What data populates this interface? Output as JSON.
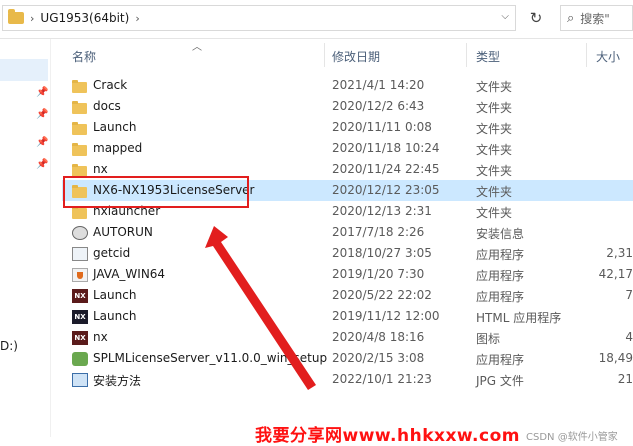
{
  "address_bar": {
    "path": "UG1953(64bit)",
    "search_placeholder": "搜索\""
  },
  "nav": {
    "partial_text": "D:)"
  },
  "columns": {
    "name": "名称",
    "date": "修改日期",
    "type": "类型",
    "size": "大小"
  },
  "files": [
    {
      "name": "Crack",
      "date": "2021/4/1 14:20",
      "type": "文件夹",
      "size": "",
      "icon": "folder"
    },
    {
      "name": "docs",
      "date": "2020/12/2 6:43",
      "type": "文件夹",
      "size": "",
      "icon": "folder"
    },
    {
      "name": "Launch",
      "date": "2020/11/11 0:08",
      "type": "文件夹",
      "size": "",
      "icon": "folder"
    },
    {
      "name": "mapped",
      "date": "2020/11/18 10:24",
      "type": "文件夹",
      "size": "",
      "icon": "folder"
    },
    {
      "name": "nx",
      "date": "2020/11/24 22:45",
      "type": "文件夹",
      "size": "",
      "icon": "folder"
    },
    {
      "name": "NX6-NX1953LicenseServer",
      "date": "2020/12/12 23:05",
      "type": "文件夹",
      "size": "",
      "icon": "folder"
    },
    {
      "name": "nxlauncher",
      "date": "2020/12/13 2:31",
      "type": "文件夹",
      "size": "",
      "icon": "folder"
    },
    {
      "name": "AUTORUN",
      "date": "2017/7/18 2:26",
      "type": "安装信息",
      "size": "",
      "icon": "gear"
    },
    {
      "name": "getcid",
      "date": "2018/10/27 3:05",
      "type": "应用程序",
      "size": "2,31",
      "icon": "app"
    },
    {
      "name": "JAVA_WIN64",
      "date": "2019/1/20 7:30",
      "type": "应用程序",
      "size": "42,17",
      "icon": "java"
    },
    {
      "name": "Launch",
      "date": "2020/5/22 22:02",
      "type": "应用程序",
      "size": "7",
      "icon": "nx"
    },
    {
      "name": "Launch",
      "date": "2019/11/12 12:00",
      "type": "HTML 应用程序",
      "size": "",
      "icon": "nx2"
    },
    {
      "name": "nx",
      "date": "2020/4/8 18:16",
      "type": "图标",
      "size": "4",
      "icon": "nx"
    },
    {
      "name": "SPLMLicenseServer_v11.0.0_win_setup",
      "date": "2020/2/15 3:08",
      "type": "应用程序",
      "size": "18,49",
      "icon": "pkg"
    },
    {
      "name": "安装方法",
      "date": "2022/10/1 21:23",
      "type": "JPG 文件",
      "size": "21",
      "icon": "img"
    }
  ],
  "icon_labels": {
    "nx": "NX"
  },
  "watermark": "我要分享网www.hhkxxw.com",
  "watermark_gray": "CSDN @软件小管家",
  "colors": {
    "selection": "#cce8ff",
    "annotation": "#e21e1e"
  }
}
